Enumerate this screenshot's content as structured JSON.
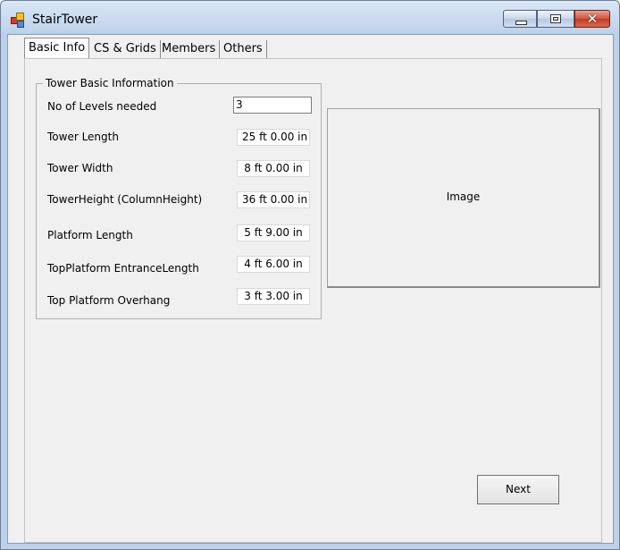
{
  "window": {
    "title": "StairTower"
  },
  "tabs": [
    {
      "label": "Basic Info",
      "selected": true
    },
    {
      "label": "CS & Grids",
      "selected": false
    },
    {
      "label": "Members",
      "selected": false
    },
    {
      "label": "Others",
      "selected": false
    }
  ],
  "group": {
    "title": "Tower Basic Information",
    "fields": [
      {
        "label": "No of Levels needed",
        "value": "3"
      },
      {
        "label": "Tower Length",
        "value": "25 ft  0.00 in"
      },
      {
        "label": "Tower Width",
        "value": "8 ft  0.00 in"
      },
      {
        "label": "TowerHeight (ColumnHeight)",
        "value": "36 ft  0.00 in"
      },
      {
        "label": "Platform Length",
        "value": "5 ft  9.00 in"
      },
      {
        "label": "TopPlatform EntranceLength",
        "value": "4 ft  6.00 in"
      },
      {
        "label": "Top Platform Overhang",
        "value": "3 ft  3.00 in"
      }
    ]
  },
  "image_box": {
    "label": "Image"
  },
  "buttons": {
    "next": "Next"
  },
  "icons": {
    "app": "app-icon",
    "minimize": "minimize-icon",
    "maximize": "maximize-icon",
    "close": "close-icon"
  },
  "colors": {
    "titlebar": "#c3d6ec",
    "close_button": "#c23b23",
    "client_bg": "#f0f0f0"
  }
}
